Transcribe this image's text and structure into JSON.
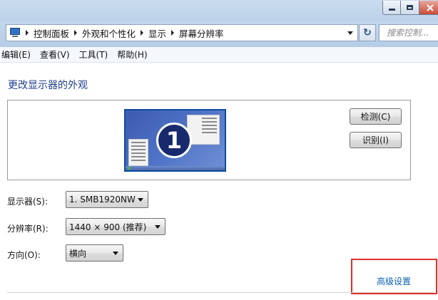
{
  "window": {
    "controls": [
      "minimize-icon",
      "maximize-icon",
      "close-icon"
    ],
    "accent": "#bcd2ea"
  },
  "address_bar": {
    "breadcrumbs": [
      "控制面板",
      "外观和个性化",
      "显示",
      "屏幕分辨率"
    ],
    "search_placeholder": "搜索控制..."
  },
  "menu": [
    "编辑(E)",
    "查看(V)",
    "工具(T)",
    "帮助(H)"
  ],
  "main": {
    "heading": "更改显示器的外观",
    "monitor_number": "1",
    "detect_button": "检测(C)",
    "identify_button": "识别(I)",
    "fields": {
      "display_label": "显示器(S):",
      "display_value": "1. SMB1920NW",
      "resolution_label": "分辨率(R):",
      "resolution_value": "1440 × 900 (推荐)",
      "orientation_label": "方向(O):",
      "orientation_value": "横向"
    },
    "advanced_link": "高级设置",
    "link_color": "#0b5fb4",
    "highlight_color": "#e0302a"
  }
}
